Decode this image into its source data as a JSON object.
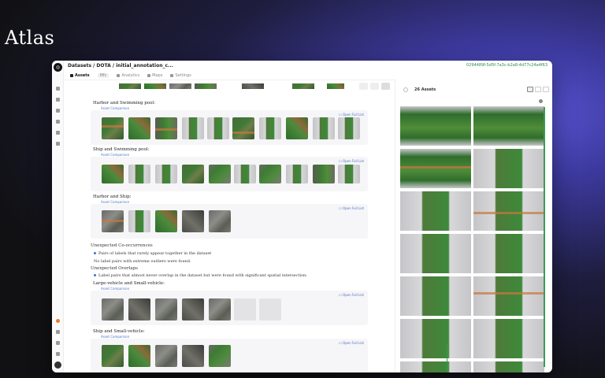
{
  "brand": "Atlas",
  "window": {
    "breadcrumb": "Datasets / DOTA / initial_annotation_c...",
    "uuid": "0294489f-5d5f-7a3c-b2a8-4d77c24a4f63"
  },
  "tabs": [
    {
      "label": "Assets",
      "active": true
    },
    {
      "label": "Mfc",
      "active": false,
      "pill": true
    },
    {
      "label": "Analytics",
      "active": false
    },
    {
      "label": "Maps",
      "active": false
    },
    {
      "label": "Settings",
      "active": false
    }
  ],
  "sections": {
    "harbor_pool": {
      "title": "Harbor and Swimming pool:",
      "link": "Asset Comparison",
      "open": "Open Full List"
    },
    "ship_pool": {
      "title": "Ship and Swimming pool:",
      "link": "Asset Comparison",
      "open": "Open Full List"
    },
    "harbor_ship": {
      "title": "Harbor and Ship:",
      "link": "Asset Comparison",
      "open": "Open Full List"
    },
    "cooccurrences": {
      "heading": "Unexpected Co-occurrences",
      "bullet": "Pairs of labels that rarely appear together in the dataset",
      "note": "No label pairs with extreme outliers were found."
    },
    "overlaps": {
      "heading": "Unexpected Overlaps",
      "bullet": "Label pairs that almost never overlap in the dataset but were found with significant spatial intersection:"
    },
    "lv_sv": {
      "title": "Large-vehicle and Small-vehicle:",
      "link": "Asset Comparison",
      "open": "Open Full List"
    },
    "ship_sv": {
      "title": "Ship and Small-vehicle:",
      "link": "Asset Comparison",
      "open": "Open Full List"
    }
  },
  "right_panel": {
    "count": "26 Assets"
  }
}
